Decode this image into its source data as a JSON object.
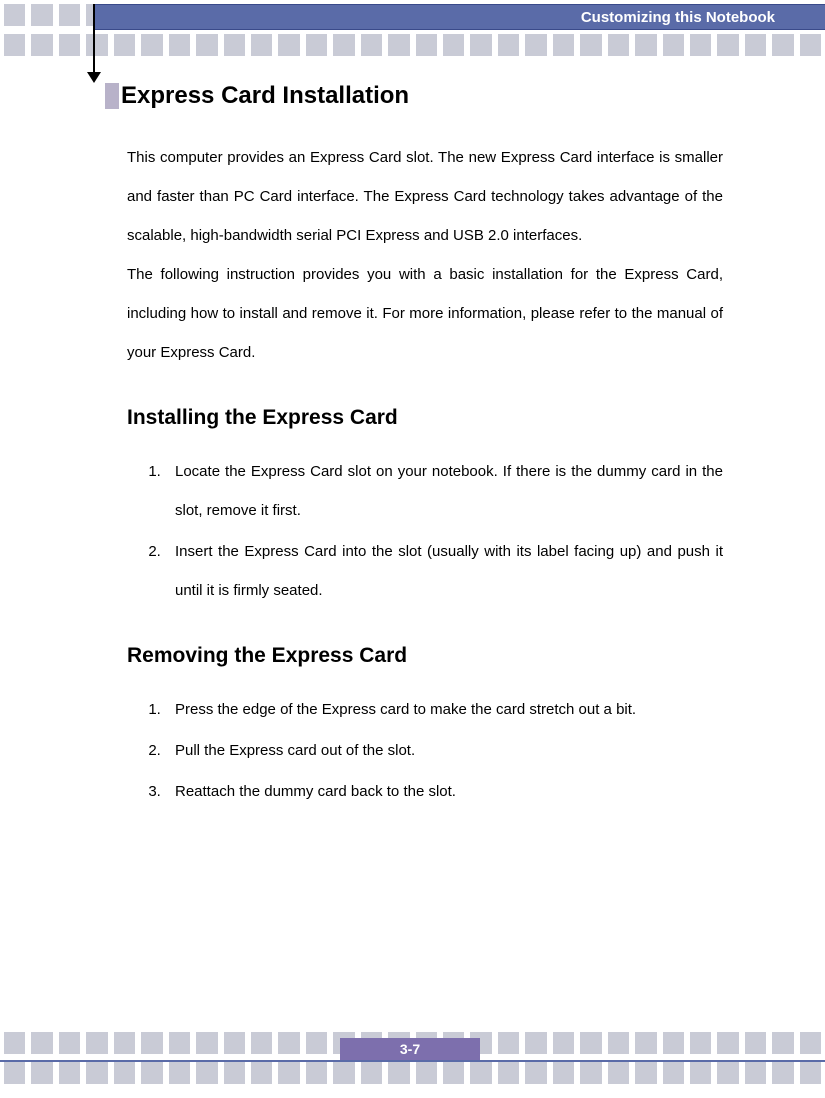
{
  "header": {
    "title": "Customizing this Notebook"
  },
  "main": {
    "heading": "Express Card Installation",
    "intro_p1": "This computer provides an Express Card slot.   The new Express Card interface is smaller and faster than PC Card interface.   The Express Card technology takes advantage of the scalable, high-bandwidth serial PCI Express and USB 2.0 interfaces.",
    "intro_p2": "The following instruction provides you with a basic installation for the Express Card, including how to install and remove it.   For more information, please refer to the manual of your Express Card.",
    "install_heading": "Installing the Express Card",
    "install_steps": [
      "Locate the Express Card slot on your notebook.   If there is the dummy card in the slot, remove it first.",
      "Insert the Express Card into the slot (usually with its label facing up) and push it until it is firmly seated."
    ],
    "remove_heading": "Removing the Express Card",
    "remove_steps": [
      "Press the edge of the Express card to make the card stretch out a bit.",
      "Pull the Express card out of the slot.",
      "Reattach the dummy card back to the slot."
    ]
  },
  "footer": {
    "page": "3-7"
  }
}
